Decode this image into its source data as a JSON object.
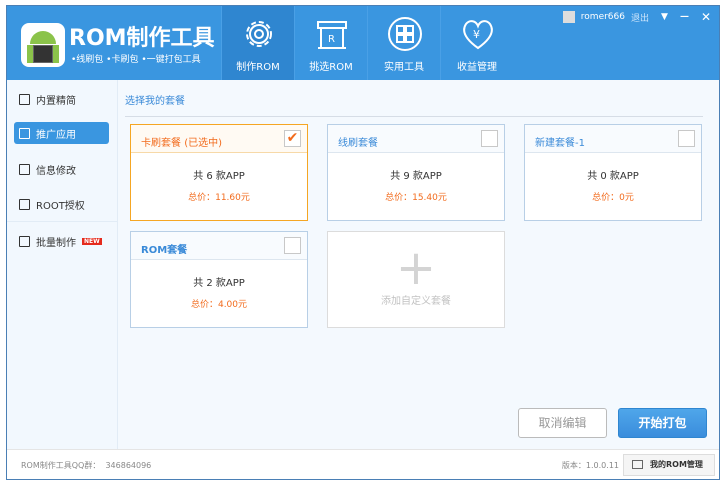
{
  "app": {
    "title": "ROM制作工具",
    "subtitle": "•线刷包  •卡刷包  •一键打包工具"
  },
  "nav": [
    {
      "label": "制作ROM",
      "icon": "gear-icon"
    },
    {
      "label": "挑选ROM",
      "icon": "shop-icon"
    },
    {
      "label": "实用工具",
      "icon": "grid-icon"
    },
    {
      "label": "收益管理",
      "icon": "heart-yen-icon"
    }
  ],
  "user": {
    "name": "romer666",
    "logout": "退出"
  },
  "sidebar": [
    {
      "label": "内置精简"
    },
    {
      "label": "推广应用"
    },
    {
      "label": "信息修改"
    },
    {
      "label": "ROOT授权"
    },
    {
      "label": "批量制作",
      "badge": "NEW"
    }
  ],
  "section_title": "选择我的套餐",
  "packages": [
    {
      "name": "卡刷套餐",
      "tag": "(已选中)",
      "count": "共 6 款APP",
      "price": "总价：11.60元",
      "selected": true
    },
    {
      "name": "线刷套餐",
      "count": "共 9 款APP",
      "price": "总价：15.40元",
      "selected": false
    },
    {
      "name": "新建套餐-1",
      "count": "共 0 款APP",
      "price": "总价：0元",
      "selected": false
    },
    {
      "name": "ROM套餐",
      "count": "共 2 款APP",
      "price": "总价：4.00元",
      "selected": false
    }
  ],
  "add_package": "添加自定义套餐",
  "buttons": {
    "cancel": "取消编辑",
    "start": "开始打包"
  },
  "footer": {
    "qq_label": "ROM制作工具QQ群：",
    "qq": "346864096",
    "version": "版本：1.0.0.11",
    "manage": "我的ROM管理"
  },
  "colors": {
    "primary": "#3a96e0",
    "accent": "#f26b1d"
  }
}
